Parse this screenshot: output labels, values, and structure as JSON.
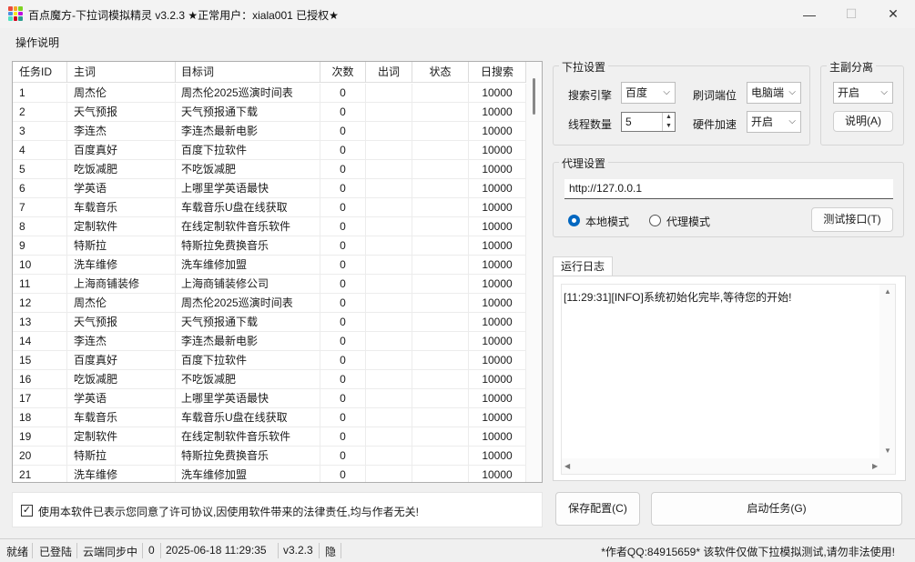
{
  "window": {
    "title": "百点魔方-下拉词模拟精灵 v3.2.3  ★正常用户：xiala001 已授权★",
    "min_glyph": "—",
    "max_glyph": "☐",
    "close_glyph": "✕"
  },
  "menu": {
    "help": "操作说明"
  },
  "table": {
    "headers": [
      "任务ID",
      "主词",
      "目标词",
      "次数",
      "出词",
      "状态",
      "日搜索"
    ],
    "rows": [
      [
        "1",
        "周杰伦",
        "周杰伦2025巡演时间表",
        "0",
        "",
        "",
        "10000"
      ],
      [
        "2",
        "天气预报",
        "天气预报通下载",
        "0",
        "",
        "",
        "10000"
      ],
      [
        "3",
        "李连杰",
        "李连杰最新电影",
        "0",
        "",
        "",
        "10000"
      ],
      [
        "4",
        "百度真好",
        "百度下拉软件",
        "0",
        "",
        "",
        "10000"
      ],
      [
        "5",
        "吃饭减肥",
        "不吃饭减肥",
        "0",
        "",
        "",
        "10000"
      ],
      [
        "6",
        "学英语",
        "上哪里学英语最快",
        "0",
        "",
        "",
        "10000"
      ],
      [
        "7",
        "车载音乐",
        "车载音乐U盘在线获取",
        "0",
        "",
        "",
        "10000"
      ],
      [
        "8",
        "定制软件",
        "在线定制软件音乐软件",
        "0",
        "",
        "",
        "10000"
      ],
      [
        "9",
        "特斯拉",
        "特斯拉免费换音乐",
        "0",
        "",
        "",
        "10000"
      ],
      [
        "10",
        "洗车维修",
        "洗车维修加盟",
        "0",
        "",
        "",
        "10000"
      ],
      [
        "11",
        "上海商铺装修",
        "上海商铺装修公司",
        "0",
        "",
        "",
        "10000"
      ],
      [
        "12",
        "周杰伦",
        "周杰伦2025巡演时间表",
        "0",
        "",
        "",
        "10000"
      ],
      [
        "13",
        "天气预报",
        "天气预报通下载",
        "0",
        "",
        "",
        "10000"
      ],
      [
        "14",
        "李连杰",
        "李连杰最新电影",
        "0",
        "",
        "",
        "10000"
      ],
      [
        "15",
        "百度真好",
        "百度下拉软件",
        "0",
        "",
        "",
        "10000"
      ],
      [
        "16",
        "吃饭减肥",
        "不吃饭减肥",
        "0",
        "",
        "",
        "10000"
      ],
      [
        "17",
        "学英语",
        "上哪里学英语最快",
        "0",
        "",
        "",
        "10000"
      ],
      [
        "18",
        "车载音乐",
        "车载音乐U盘在线获取",
        "0",
        "",
        "",
        "10000"
      ],
      [
        "19",
        "定制软件",
        "在线定制软件音乐软件",
        "0",
        "",
        "",
        "10000"
      ],
      [
        "20",
        "特斯拉",
        "特斯拉免费换音乐",
        "0",
        "",
        "",
        "10000"
      ],
      [
        "21",
        "洗车维修",
        "洗车维修加盟",
        "0",
        "",
        "",
        "10000"
      ]
    ]
  },
  "agreement": {
    "checked_glyph": "✓",
    "text": "使用本软件已表示您同意了许可协议,因使用软件带来的法律责任,均与作者无关!"
  },
  "dropdown_settings": {
    "title": "下拉设置",
    "search_engine_label": "搜索引擎",
    "search_engine_value": "百度",
    "refresh_port_label": "刷词端位",
    "refresh_port_value": "电脑端",
    "threads_label": "线程数量",
    "threads_value": "5",
    "hw_accel_label": "硬件加速",
    "hw_accel_value": "开启"
  },
  "main_sub": {
    "title": "主副分离",
    "value": "开启",
    "help_button": "说明(A)"
  },
  "proxy": {
    "title": "代理设置",
    "address": "http://127.0.0.1",
    "local_mode": "本地模式",
    "proxy_mode": "代理模式",
    "test_button": "测试接口(T)"
  },
  "log": {
    "tab": "运行日志",
    "lines": [
      "[11:29:31][INFO]系统初始化完毕,等待您的开始!"
    ]
  },
  "actions": {
    "save": "保存配置(C)",
    "start": "启动任务(G)"
  },
  "status": {
    "state": "就绪",
    "login": "已登陆",
    "sync": "云端同步中",
    "count": "0",
    "datetime": "2025-06-18 11:29:35",
    "version": "v3.2.3",
    "hidden": "隐",
    "notice": "*作者QQ:84915659* 该软件仅做下拉模拟测试,请勿非法使用!"
  },
  "colors": {
    "accent": "#0067c0",
    "icon_cells": [
      "#e94b3c",
      "#f5a623",
      "#7ed321",
      "#4a90e2",
      "#f8e71c",
      "#bd10e0",
      "#50e3c2",
      "#d0021b",
      "#2a9d8f"
    ]
  }
}
